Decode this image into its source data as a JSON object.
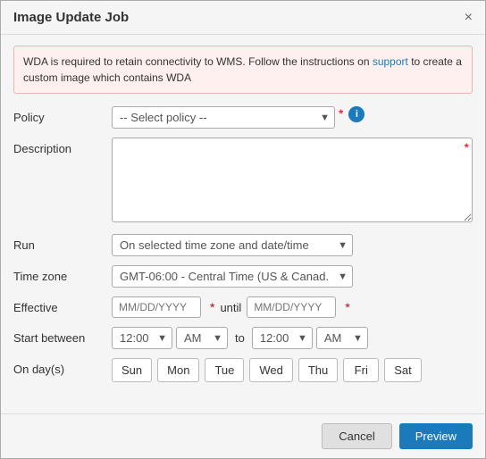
{
  "dialog": {
    "title": "Image Update Job",
    "close_label": "×"
  },
  "alert": {
    "message_before": "WDA is required to retain connectivity to WMS. Follow the instructions on ",
    "link_text": "support",
    "message_after": " to create a custom image which contains WDA"
  },
  "form": {
    "policy_label": "Policy",
    "policy_placeholder": "-- Select policy --",
    "description_label": "Description",
    "run_label": "Run",
    "run_option": "On selected time zone and date/time",
    "timezone_label": "Time zone",
    "timezone_option": "GMT-06:00 - Central Time (US & Canad.",
    "effective_label": "Effective",
    "effective_placeholder": "MM/DD/YYYY",
    "until_label": "until",
    "start_between_label": "Start between",
    "time_start": "12:00",
    "ampm_start": "AM",
    "to_label": "to",
    "time_end": "12:00",
    "ampm_end": "AM",
    "on_days_label": "On day(s)",
    "days": [
      "Sun",
      "Mon",
      "Tue",
      "Wed",
      "Thu",
      "Fri",
      "Sat"
    ]
  },
  "footer": {
    "cancel_label": "Cancel",
    "preview_label": "Preview"
  }
}
